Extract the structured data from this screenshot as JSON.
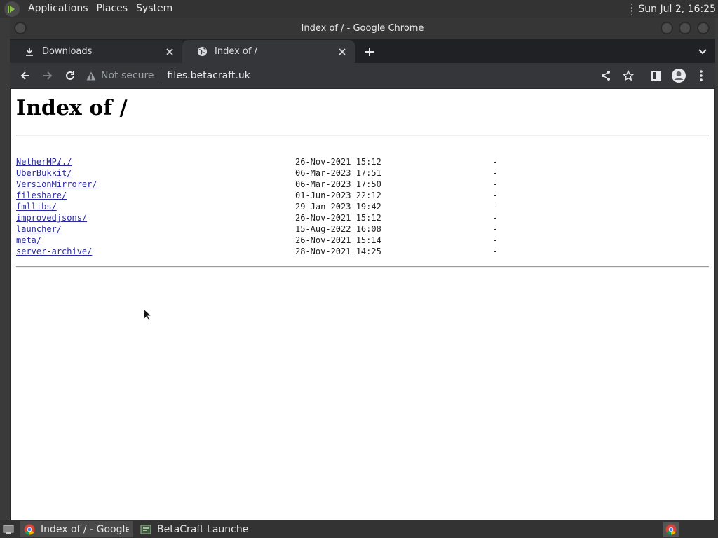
{
  "top_panel": {
    "menus": [
      "Applications",
      "Places",
      "System"
    ],
    "clock": "Sun Jul  2, 16:25"
  },
  "window": {
    "title": "Index of / - Google Chrome"
  },
  "tabs": [
    {
      "label": "Downloads",
      "icon": "download-icon",
      "active": false
    },
    {
      "label": "Index of /",
      "icon": "globe-icon",
      "active": true
    }
  ],
  "toolbar": {
    "security_label": "Not secure",
    "url": "files.betacraft.uk"
  },
  "page": {
    "heading": "Index of /",
    "parent_link": "../",
    "entries": [
      {
        "name": "NetherMP/",
        "date": "26-Nov-2021 15:12",
        "size": "-"
      },
      {
        "name": "UberBukkit/",
        "date": "06-Mar-2023 17:51",
        "size": "-"
      },
      {
        "name": "VersionMirrorer/",
        "date": "06-Mar-2023 17:50",
        "size": "-"
      },
      {
        "name": "fileshare/",
        "date": "01-Jun-2023 22:12",
        "size": "-"
      },
      {
        "name": "fmllibs/",
        "date": "29-Jan-2023 19:42",
        "size": "-"
      },
      {
        "name": "improvedjsons/",
        "date": "26-Nov-2021 15:12",
        "size": "-"
      },
      {
        "name": "launcher/",
        "date": "15-Aug-2022 16:08",
        "size": "-"
      },
      {
        "name": "meta/",
        "date": "26-Nov-2021 15:14",
        "size": "-"
      },
      {
        "name": "server-archive/",
        "date": "28-Nov-2021 14:25",
        "size": "-"
      }
    ]
  },
  "taskbar": {
    "tasks": [
      {
        "label": "Index of / - Google ...",
        "icon": "chrome-icon",
        "active": true
      },
      {
        "label": "BetaCraft Launcher ...",
        "icon": "java-app-icon",
        "active": false
      }
    ]
  }
}
